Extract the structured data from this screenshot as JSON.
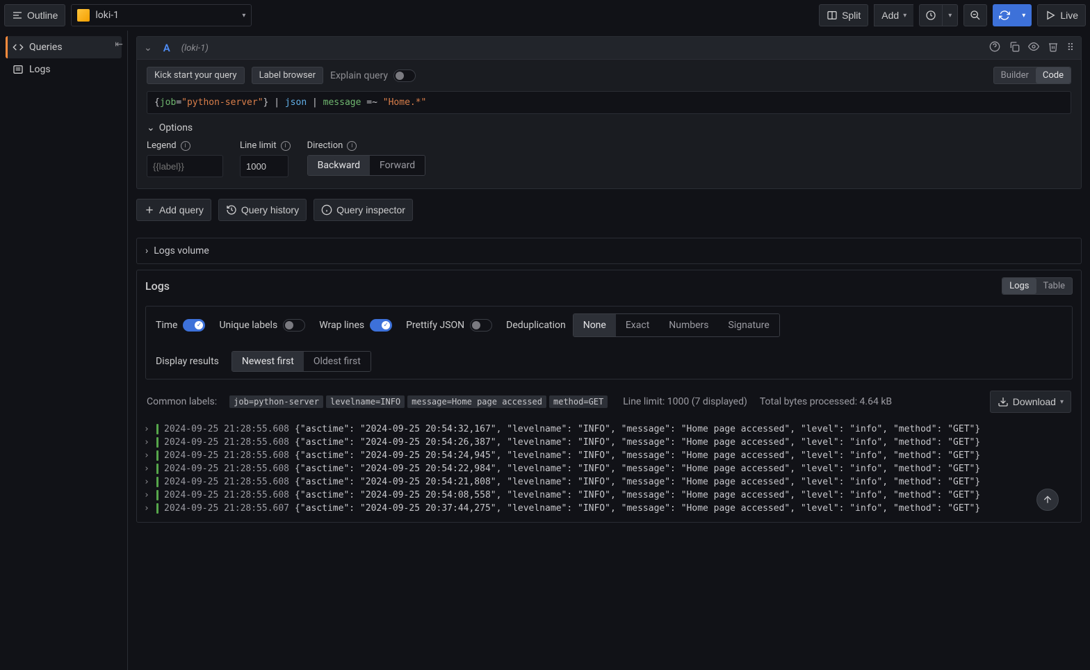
{
  "topbar": {
    "outline": "Outline",
    "datasource": "loki-1",
    "split": "Split",
    "add": "Add",
    "live": "Live"
  },
  "sidebar": {
    "items": [
      {
        "label": "Queries"
      },
      {
        "label": "Logs"
      }
    ]
  },
  "query": {
    "letter": "A",
    "subtitle": "(loki-1)",
    "kickstart": "Kick start your query",
    "labelBrowser": "Label browser",
    "explain": "Explain query",
    "builder": "Builder",
    "code": "Code",
    "expr": {
      "job_key": "job",
      "job_val": "\"python-server\"",
      "json": "json",
      "message": "message",
      "regex": "\"Home.*\""
    },
    "options": "Options",
    "legend": "Legend",
    "legend_ph": "{{label}}",
    "linelimit": "Line limit",
    "linelimit_val": "1000",
    "direction": "Direction",
    "backward": "Backward",
    "forward": "Forward"
  },
  "actions": {
    "add": "Add query",
    "history": "Query history",
    "inspector": "Query inspector"
  },
  "logsVolume": "Logs volume",
  "logs": {
    "title": "Logs",
    "tab_logs": "Logs",
    "tab_table": "Table",
    "time": "Time",
    "unique": "Unique labels",
    "wrap": "Wrap lines",
    "pretty": "Prettify JSON",
    "dedup": "Deduplication",
    "none": "None",
    "exact": "Exact",
    "numbers": "Numbers",
    "signature": "Signature",
    "display": "Display results",
    "newest": "Newest first",
    "oldest": "Oldest first",
    "common": "Common labels:",
    "common_labels": [
      "job=python-server",
      "levelname=INFO",
      "message=Home page accessed",
      "method=GET"
    ],
    "linelimit_info": "Line limit: 1000 (7 displayed)",
    "bytes": "Total bytes processed: 4.64 kB",
    "download": "Download",
    "rows": [
      {
        "ts": "2024-09-25 21:28:55.608",
        "msg": "{\"asctime\": \"2024-09-25 20:54:32,167\", \"levelname\": \"INFO\", \"message\": \"Home page accessed\", \"level\": \"info\", \"method\": \"GET\"}"
      },
      {
        "ts": "2024-09-25 21:28:55.608",
        "msg": "{\"asctime\": \"2024-09-25 20:54:26,387\", \"levelname\": \"INFO\", \"message\": \"Home page accessed\", \"level\": \"info\", \"method\": \"GET\"}"
      },
      {
        "ts": "2024-09-25 21:28:55.608",
        "msg": "{\"asctime\": \"2024-09-25 20:54:24,945\", \"levelname\": \"INFO\", \"message\": \"Home page accessed\", \"level\": \"info\", \"method\": \"GET\"}"
      },
      {
        "ts": "2024-09-25 21:28:55.608",
        "msg": "{\"asctime\": \"2024-09-25 20:54:22,984\", \"levelname\": \"INFO\", \"message\": \"Home page accessed\", \"level\": \"info\", \"method\": \"GET\"}"
      },
      {
        "ts": "2024-09-25 21:28:55.608",
        "msg": "{\"asctime\": \"2024-09-25 20:54:21,808\", \"levelname\": \"INFO\", \"message\": \"Home page accessed\", \"level\": \"info\", \"method\": \"GET\"}"
      },
      {
        "ts": "2024-09-25 21:28:55.608",
        "msg": "{\"asctime\": \"2024-09-25 20:54:08,558\", \"levelname\": \"INFO\", \"message\": \"Home page accessed\", \"level\": \"info\", \"method\": \"GET\"}"
      },
      {
        "ts": "2024-09-25 21:28:55.607",
        "msg": "{\"asctime\": \"2024-09-25 20:37:44,275\", \"levelname\": \"INFO\", \"message\": \"Home page accessed\", \"level\": \"info\", \"method\": \"GET\"}"
      }
    ]
  }
}
